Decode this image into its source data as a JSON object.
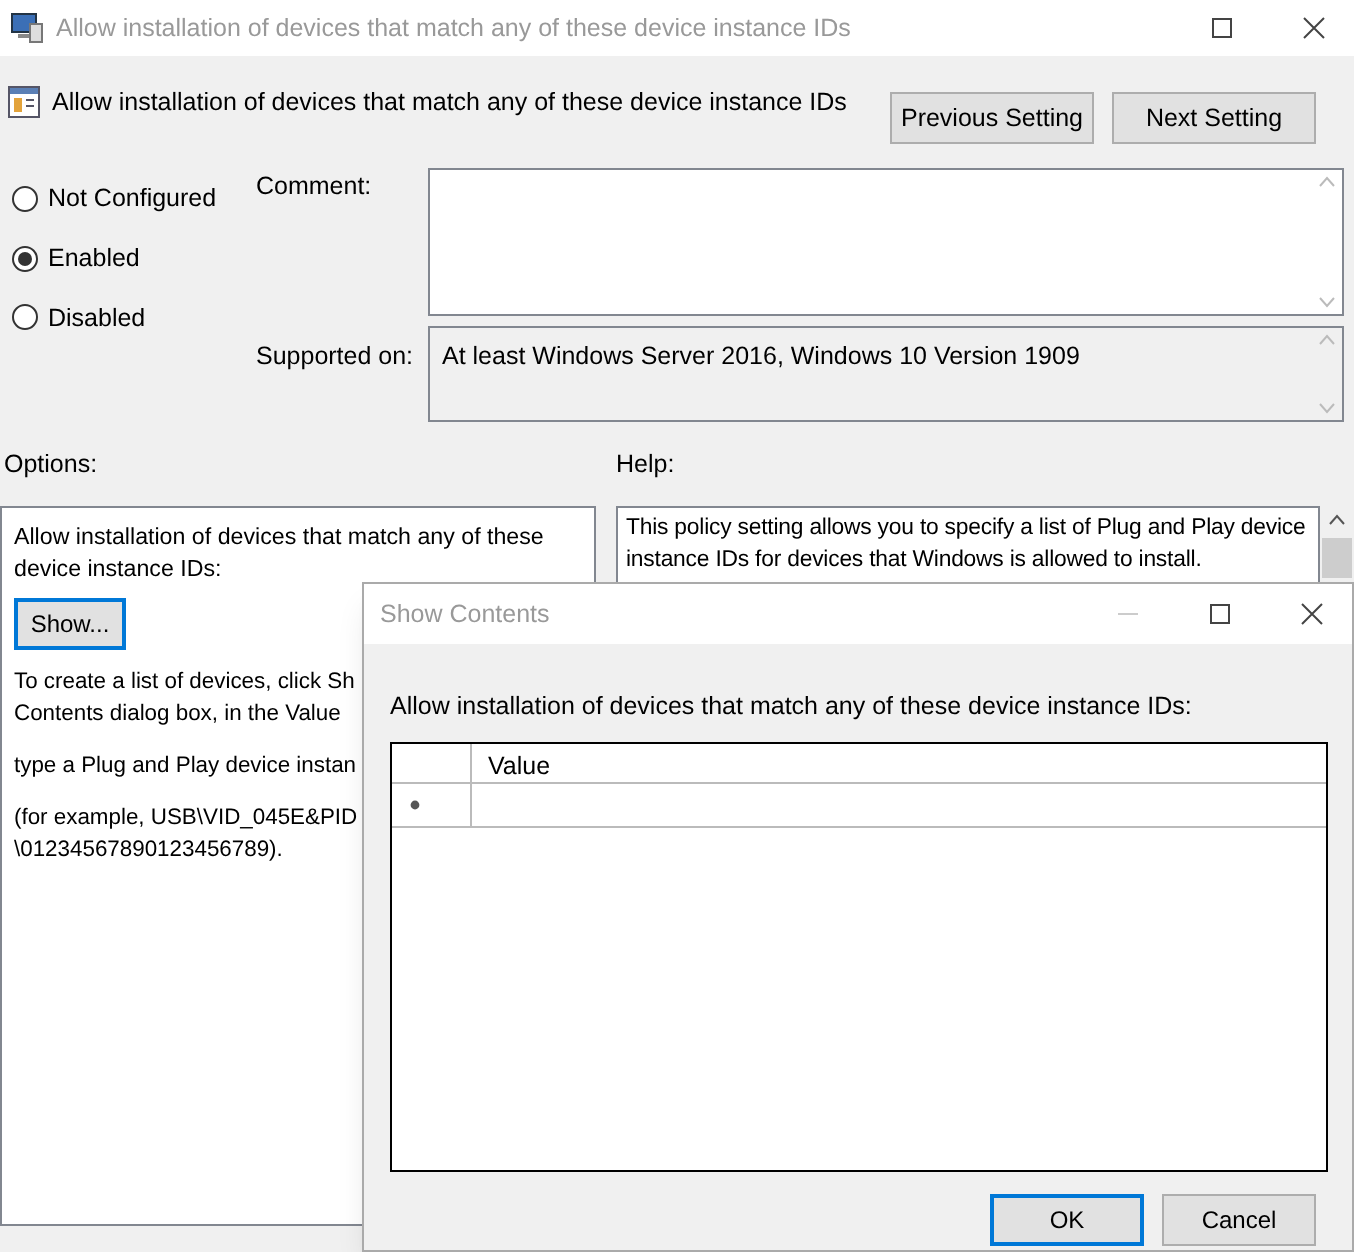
{
  "window": {
    "title": "Allow installation of devices that match any of these device instance IDs"
  },
  "header": {
    "title": "Allow installation of devices that match any of these device instance IDs"
  },
  "nav_buttons": [
    "Previous Setting",
    "Next Setting"
  ],
  "state_options": [
    {
      "label": "Not Configured",
      "selected": false
    },
    {
      "label": "Enabled",
      "selected": true
    },
    {
      "label": "Disabled",
      "selected": false
    }
  ],
  "comment": {
    "label": "Comment:"
  },
  "supported_on": {
    "label": "Supported on:",
    "value": "At least Windows Server 2016, Windows 10 Version 1909"
  },
  "options": {
    "label": "Options:",
    "description": "Allow installation of devices that match any of these device instance IDs:",
    "show_button": {
      "label": "Show...",
      "focused": true
    },
    "lines": [
      "To create a list of devices, click Sh",
      "Contents dialog box, in the Value",
      "type a Plug and Play device instan",
      "(for example, USB\\VID_045E&PID",
      "\\01234567890123456789)."
    ]
  },
  "help": {
    "label": "Help:",
    "text": "This policy setting allows you to specify a list of Plug and Play device instance IDs for devices that Windows is allowed to install."
  },
  "dialog": {
    "title": "Show Contents",
    "label": "Allow installation of devices that match any of these device instance IDs:",
    "table": {
      "columns": [
        "Value"
      ]
    },
    "buttons": [
      {
        "label": "OK",
        "focused": true
      },
      {
        "label": "Cancel",
        "focused": false
      }
    ]
  }
}
